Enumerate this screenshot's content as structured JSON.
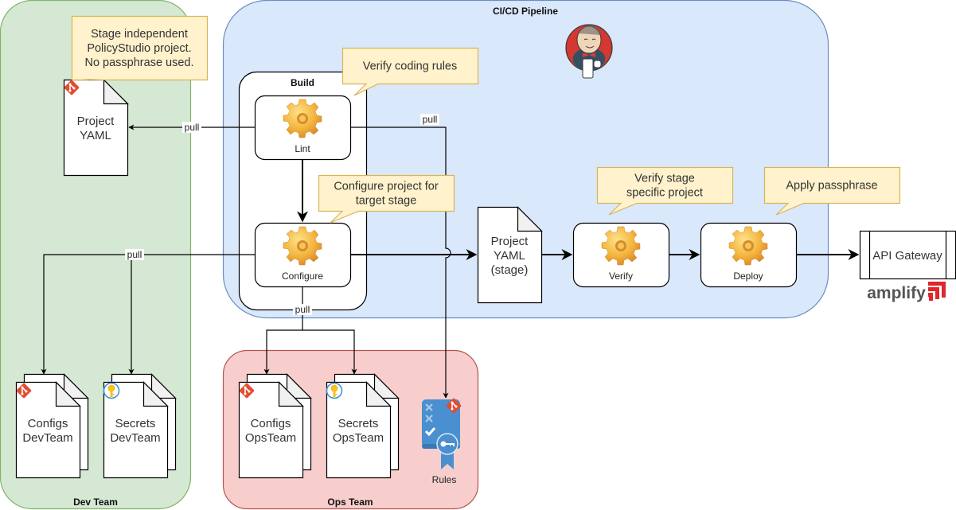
{
  "containers": {
    "dev_team": {
      "label": "Dev Team",
      "fill": "#d5e8d4",
      "stroke": "#82b366"
    },
    "cicd": {
      "label": "CI/CD Pipeline",
      "fill": "#dae8fc",
      "stroke": "#6c8ebf"
    },
    "ops_team": {
      "label": "Ops Team",
      "fill": "#f8cecc",
      "stroke": "#b85450"
    },
    "build": {
      "label": "Build"
    }
  },
  "notes": {
    "stage_independent": [
      "Stage independent",
      "PolicyStudio project.",
      "No passphrase used."
    ],
    "verify_coding": [
      "Verify coding rules"
    ],
    "configure_target": [
      "Configure project for",
      "target stage"
    ],
    "verify_stage": [
      "Verify stage",
      "specific project"
    ],
    "apply_passphrase": [
      "Apply passphrase"
    ]
  },
  "steps": {
    "lint": "Lint",
    "configure": "Configure",
    "verify": "Verify",
    "deploy": "Deploy"
  },
  "documents": {
    "project_yaml": [
      "Project",
      "YAML"
    ],
    "project_yaml_stage": [
      "Project",
      "YAML",
      "(stage)"
    ],
    "configs_dev": [
      "Configs",
      "DevTeam"
    ],
    "secrets_dev": [
      "Secrets",
      "DevTeam"
    ],
    "configs_ops": [
      "Configs",
      "OpsTeam"
    ],
    "secrets_ops": [
      "Secrets",
      "OpsTeam"
    ],
    "rules": "Rules"
  },
  "gateway": {
    "label": "API Gateway",
    "brand": "amplify",
    "brand_color": "#e0262c"
  },
  "edges": {
    "pull": "pull"
  },
  "colors": {
    "note_fill": "#fff2cc",
    "note_stroke": "#d6b656",
    "gear": "#f0a830",
    "git": "#e44c30",
    "key_ring": "#3b8fd9",
    "rules_blue": "#4a8fcf"
  }
}
